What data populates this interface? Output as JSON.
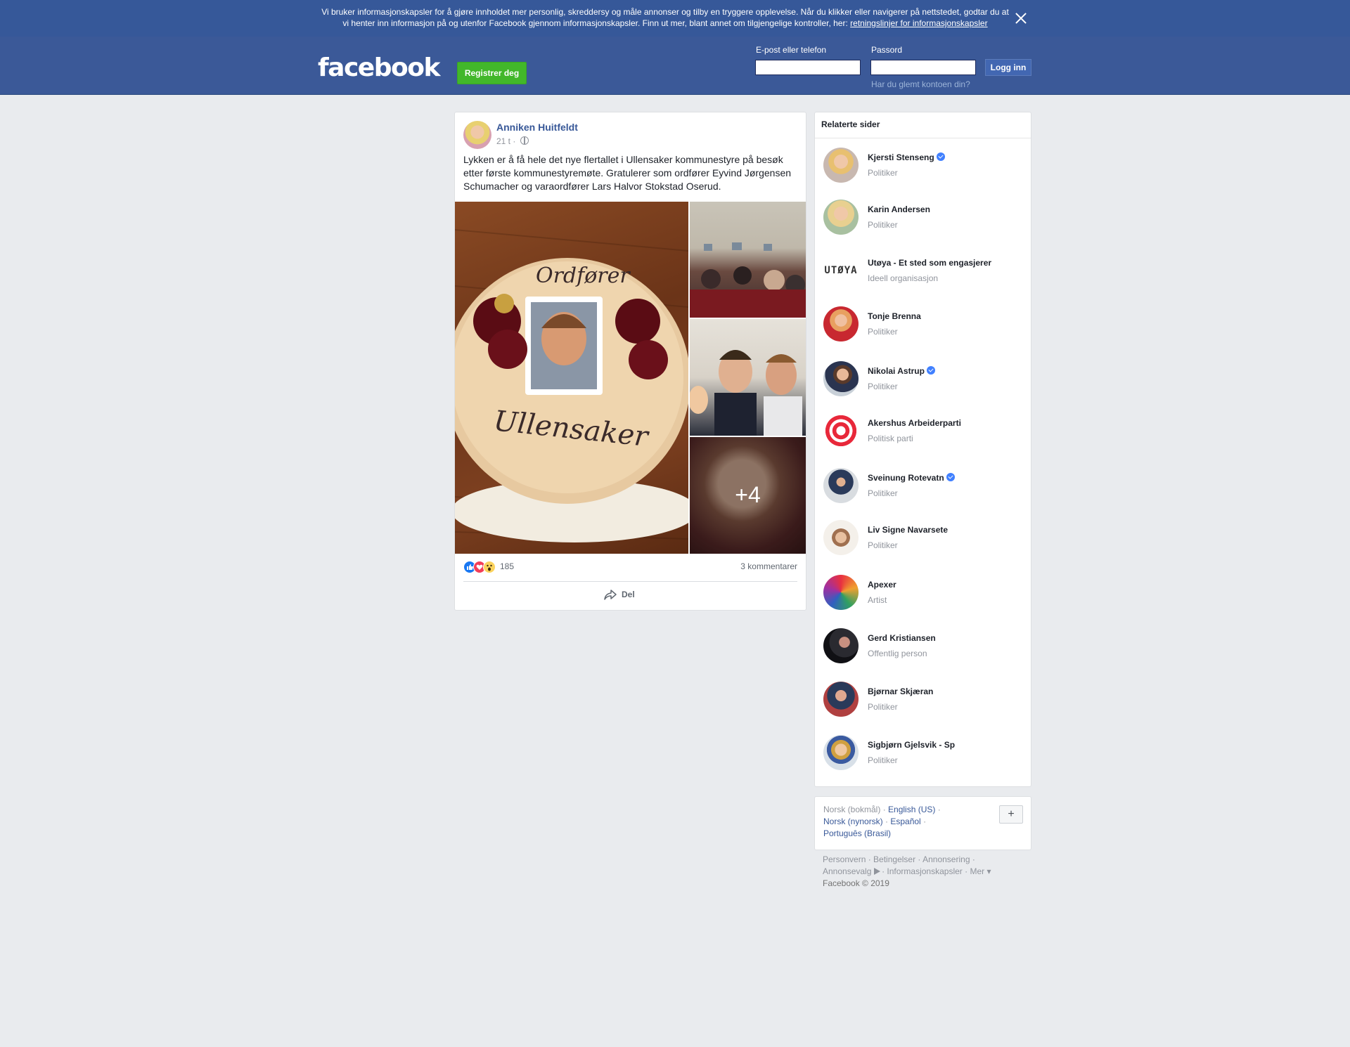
{
  "cookie_banner": {
    "text": "Vi bruker informasjonskapsler for å gjøre innholdet mer personlig, skreddersy og måle annonser og tilby en tryggere opplevelse. Når du klikker eller navigerer på nettstedet, godtar du at vi henter inn informasjon på og utenfor Facebook gjennom informasjonskapsler. Finn ut mer, blant annet om tilgjengelige kontroller, her: ",
    "link": "retningslinjer for informasjonskapsler",
    "close_icon": "close-icon"
  },
  "header": {
    "logo": "facebook",
    "register_label": "Registrer deg",
    "email_label": "E-post eller telefon",
    "password_label": "Passord",
    "login_label": "Logg inn",
    "forgot_label": "Har du glemt kontoen din?"
  },
  "post": {
    "author": "Anniken Huitfeldt",
    "time": "21 t",
    "separator": " · ",
    "audience_icon": "globe-icon",
    "text": "Lykken er å få hele det nye flertallet i Ullensaker kommunestyre på besøk etter første kommunestyremøte. Gratulerer som ordfører Eyvind Jørgensen Schumacher og varaordfører Lars Halvor Stokstad Oserud.",
    "more_photos": "+4",
    "reaction_count": "185",
    "comments": "3 kommentarer",
    "share_label": "Del",
    "colors": {
      "link": "#385898",
      "brand": "#3b5998",
      "register": "#42b72a"
    }
  },
  "related": {
    "title": "Relaterte sider",
    "items": [
      {
        "name": "Kjersti Stenseng",
        "category": "Politiker",
        "verified": true
      },
      {
        "name": "Karin Andersen",
        "category": "Politiker",
        "verified": false
      },
      {
        "name": "Utøya - Et sted som engasjerer",
        "category": "Ideell organisasjon",
        "verified": false,
        "logo_text": "UTØYA"
      },
      {
        "name": "Tonje Brenna",
        "category": "Politiker",
        "verified": false
      },
      {
        "name": "Nikolai Astrup",
        "category": "Politiker",
        "verified": true
      },
      {
        "name": "Akershus Arbeiderparti",
        "category": "Politisk parti",
        "verified": false
      },
      {
        "name": "Sveinung Rotevatn",
        "category": "Politiker",
        "verified": true
      },
      {
        "name": "Liv Signe Navarsete",
        "category": "Politiker",
        "verified": false
      },
      {
        "name": "Apexer",
        "category": "Artist",
        "verified": false
      },
      {
        "name": "Gerd Kristiansen",
        "category": "Offentlig person",
        "verified": false
      },
      {
        "name": "Bjørnar Skjæran",
        "category": "Politiker",
        "verified": false
      },
      {
        "name": "Sigbjørn Gjelsvik - Sp",
        "category": "Politiker",
        "verified": false
      }
    ]
  },
  "languages": {
    "current": "Norsk (bokmål)",
    "others": [
      "English (US)",
      "Norsk (nynorsk)",
      "Español",
      "Português (Brasil)"
    ],
    "add_label": "+"
  },
  "footer": {
    "links": [
      "Personvern",
      "Betingelser",
      "Annonsering",
      "Annonsevalg",
      "Informasjonskapsler",
      "Mer"
    ],
    "copyright": "Facebook © 2019"
  }
}
